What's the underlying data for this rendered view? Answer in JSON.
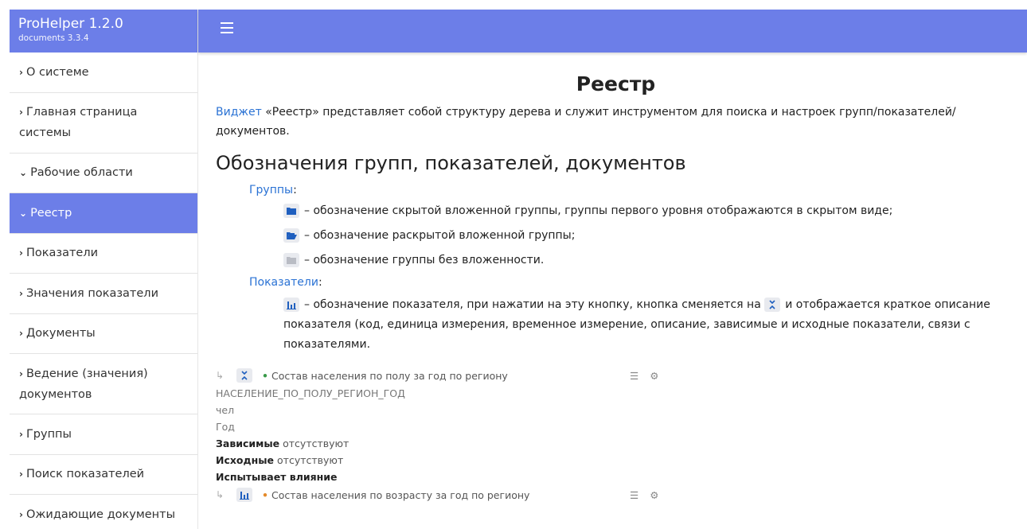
{
  "brand": {
    "title": "ProHelper 1.2.0",
    "subtitle": "documents 3.3.4"
  },
  "sidebar": {
    "items": [
      {
        "label": "О системе",
        "expanded": false
      },
      {
        "label": "Главная страница системы",
        "expanded": false
      },
      {
        "label": "Рабочие области",
        "expanded": true
      },
      {
        "label": "Реестр",
        "expanded": true,
        "active": true
      },
      {
        "label": "Показатели",
        "expanded": false
      },
      {
        "label": "Значения показатели",
        "expanded": false
      },
      {
        "label": "Документы",
        "expanded": false
      },
      {
        "label": "Ведение (значения) документов",
        "expanded": false
      },
      {
        "label": "Группы",
        "expanded": false
      },
      {
        "label": "Поиск показателей",
        "expanded": false
      },
      {
        "label": "Ожидающие документы",
        "expanded": false
      }
    ]
  },
  "colors": {
    "accent": "#6c7ee8",
    "link": "#2a72d4",
    "icon_blue": "#1f5fbf"
  },
  "main": {
    "title": "Реестр",
    "intro_link": "Виджет",
    "intro_text": " «Реестр» представляет собой структуру дерева и служит инструментом для поиска и настроек групп/показателей/ документов.",
    "section_title": "Обозначения групп, показателей, документов",
    "groups_label": "Группы",
    "groups": [
      {
        "icon": "folder-closed-icon",
        "text": "– обозначение скрытой вложенной группы, группы первого уровня отображаются в скрытом виде;"
      },
      {
        "icon": "folder-open-icon",
        "text": "– обозначение раскрытой вложенной группы;"
      },
      {
        "icon": "folder-empty-icon",
        "text": "– обозначение группы без вложенности."
      }
    ],
    "indicators_label": "Показатели",
    "indicators_text_1": "– обозначение показателя, при нажатии на эту кнопку, кнопка сменяется на",
    "indicators_text_2": "и отображается краткое описание показателя (код, единица измерения, временное измерение, описание, зависимые и исходные показатели, связи с показателями.",
    "colon": ":"
  },
  "tree": {
    "row1": "Состав населения по полу за год по региону",
    "code": "НАСЕЛЕНИЕ_ПО_ПОЛУ_РЕГИОН_ГОД",
    "unit": "чел",
    "period": "Год",
    "dependent_label": "Зависимые",
    "dependent_value": " отсутствуют",
    "source_label": "Исходные",
    "source_value": " отсутствуют",
    "influence_label": "Испытывает влияние",
    "row2": "Состав населения по возрасту за год по региону"
  }
}
